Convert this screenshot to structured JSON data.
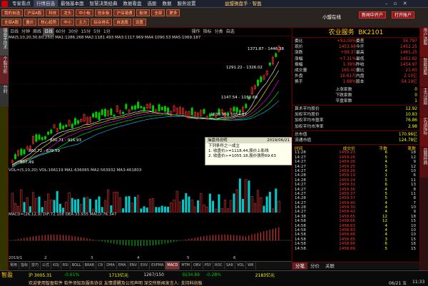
{
  "menu": {
    "items": [
      "专家看点",
      "行情自选",
      "最强基本面",
      "智慧决策经典",
      "数据看盘",
      "选股",
      "数据",
      "服务设置"
    ],
    "title": "益盟操盘手 · 智盈",
    "right": [
      "小盟在线",
      "新闻中开户",
      "打开账户"
    ]
  },
  "toolbar": {
    "row1": [
      "我的自选",
      "沪深A股",
      "科技",
      "龙头",
      "中小板",
      "创业板",
      "沪深港通",
      "板块",
      "全部",
      "更多"
    ],
    "row2": [
      "全部A股",
      "量价",
      "核心趋势",
      "中小",
      "主力",
      "综合排名",
      "自选股",
      "设置"
    ]
  },
  "sidebar_left": [
    "操盘手技术",
    "个股分析",
    "分时"
  ],
  "sidebar_right": [
    "用户选股",
    "智能选股",
    "主力追踪",
    "实战指标",
    "益盟经典"
  ],
  "chart": {
    "head": [
      "日线",
      "分钟",
      "周线",
      "日线",
      "60分",
      "30分",
      "15分",
      "5分",
      "1分",
      "操作",
      "指标",
      "分类",
      "自选"
    ],
    "ma": "MA(5,10,20,30,60,250)  MA1:1286.268  MA2:1181.493  MA3:1117.969  MA4:1090.53  MA5:1069.187",
    "price_labels": {
      "p1": "1371.87 - 1446.38",
      "p2": "1291.22 - 1326.02",
      "p3": "1147.54 - 1160.68",
      "p4": "1030.90 - 1054.87",
      "p5": "830.71 - 916.93",
      "p6": "860.72 - 879.59",
      "p7": "807.49"
    },
    "vol": "VOL=(5,10,20)  VOL:166119  MA1:636065  MA2:563932  MA3:461803",
    "macd": "MACD=(26,12,9)  DIF:72.108  DEA:33.935  MACD:76.347",
    "dates": [
      "2019/1",
      "2",
      "3",
      "4",
      "5",
      "6"
    ],
    "bottom_tabs": [
      "常用",
      "指标",
      "技巧",
      "公式",
      "KDJ",
      "RSI",
      "BOLL",
      "BRAR",
      "CR",
      "DMA",
      "EMA",
      "ENV",
      "EXV",
      "EXPMA",
      "MACD",
      "MTM",
      "OBV",
      "PSY",
      "ROC",
      "SAR",
      "VOL",
      "WR"
    ]
  },
  "tooltip": {
    "title": "操盘线说明",
    "date": "2019/06/21",
    "rule": "下列条件之一成立",
    "l1": "1. 收盘价>=1118.44,股价上影线",
    "l2": "2. 收盘价>=1055.18,股价强势69.63"
  },
  "quote": {
    "name": "农业服务",
    "code": "BK2101",
    "rows": [
      [
        "委比",
        "+93.00%",
        "委差",
        "56.797"
      ],
      [
        "现价",
        "1453.88",
        "今开",
        "1452.25"
      ],
      [
        "涨跌",
        "+99.37",
        "最高",
        "1461.25"
      ],
      [
        "涨幅",
        "+7.31%",
        "最低",
        "1452.82"
      ],
      [
        "振幅",
        "1.39%",
        "昨收",
        "1454.97"
      ],
      [
        "成交量",
        "165.00",
        "量比",
        "21.60"
      ],
      [
        "外盘",
        "16.61万",
        "内盘",
        "2.10亿"
      ],
      [
        "换手",
        "1.68%",
        "股本",
        "54.19亿"
      ]
    ],
    "stats": [
      [
        "上涨家数",
        "0"
      ],
      [
        "下跌家数",
        "0"
      ],
      [
        "平盘家数",
        "1"
      ]
    ],
    "funds": [
      [
        "算术平均股价",
        "12.92"
      ],
      [
        "加权平均股价",
        "10.83"
      ],
      [
        "加权平均市盈率",
        "76.86"
      ],
      [
        "加权平均市净率",
        "2.98"
      ]
    ],
    "extra": [
      [
        "总市值",
        "170.96亿"
      ],
      [
        "流通市值",
        "124.78亿"
      ]
    ],
    "tick_header": [
      "时间",
      "成交价",
      "手数",
      "笔数"
    ],
    "ticks": [
      [
        "11:28",
        "1459.23",
        "6",
        "18"
      ],
      [
        "14:27",
        "1459.26",
        "5",
        "12"
      ],
      [
        "14:27",
        "1459.26",
        "4",
        "9"
      ],
      [
        "14:27",
        "1459.25",
        "5",
        "12"
      ],
      [
        "14:27",
        "1459.26",
        "4",
        "10"
      ],
      [
        "14:28",
        "1459.19",
        "1",
        "6"
      ],
      [
        "14:28",
        "1459.24",
        "5",
        "11"
      ],
      [
        "14:27",
        "1459.31",
        "6",
        "13"
      ],
      [
        "14:27",
        "1459.36",
        "4",
        "8"
      ],
      [
        "14:27",
        "1459.37",
        "5",
        "11"
      ],
      [
        "14:28",
        "1459.37",
        "5",
        "8"
      ],
      [
        "14:27",
        "1459.40",
        "4",
        "7"
      ],
      [
        "14:28",
        "1459.30",
        "4",
        "10"
      ],
      [
        "14:27",
        "1459.42",
        "4",
        "9"
      ],
      [
        "14:38",
        "1458.65",
        "12",
        "18"
      ],
      [
        "14:58",
        "1458.66",
        "12",
        "15"
      ],
      [
        "14:58",
        "1458.63",
        "4",
        "10"
      ],
      [
        "14:58",
        "1458.83",
        "4",
        "10"
      ],
      [
        "14:58",
        "1458.86",
        "4",
        "10"
      ],
      [
        "14:58",
        "1458.85",
        "3",
        "15"
      ],
      [
        "14:58",
        "1458.88",
        "6",
        "16"
      ],
      [
        "14:58",
        "1458.89",
        "5",
        "15"
      ]
    ],
    "tabs": [
      "分笔",
      "分价",
      "关联"
    ]
  },
  "status": {
    "logo": "智盈",
    "idx1": "沪  3005.31",
    "chg1": "-0.61%",
    "amt1": "1713亿元",
    "idx2": "1267/150",
    "idx3": "9234.89",
    "chg2": "-0.28%",
    "amt2": "2183亿元",
    "ticker": "欢迎使用智盈软件    软件须知及服务协议    友情提醒及公司声明    深交所新闻发言人: 支持科创板",
    "date": "06/21 五",
    "time": "11:33"
  },
  "colors": {
    "up": "#ff3333",
    "down": "#00cc00",
    "ma1": "#ffffff",
    "ma2": "#ffff00",
    "ma3": "#ff00ff",
    "ma4": "#00ff00",
    "ma5": "#00ccff"
  }
}
